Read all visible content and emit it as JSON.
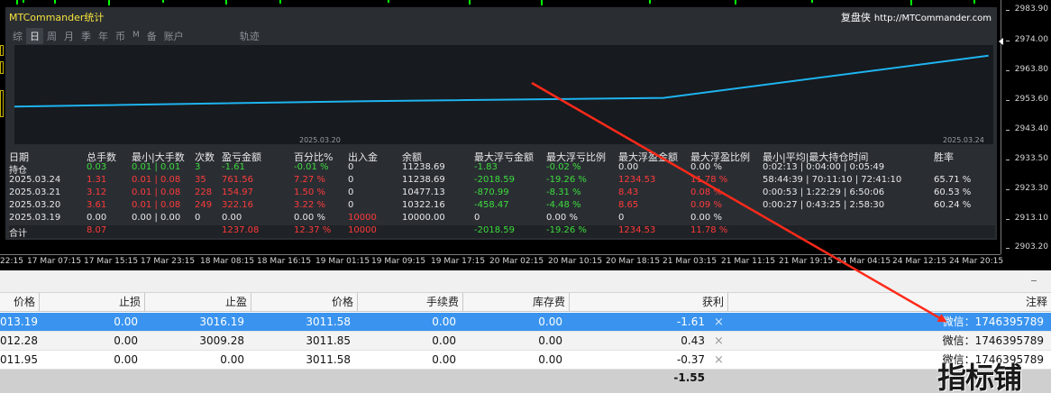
{
  "chart_window": {
    "price_axis": [
      "2983.90",
      "2974.00",
      "2963.80",
      "2953.60",
      "2943.40",
      "2933.50",
      "2923.30",
      "2913.10",
      "2903.20"
    ],
    "time_axis": [
      "22:15",
      "17 Mar 07:15",
      "17 Mar 15:15",
      "17 Mar 23:15",
      "18 Mar 08:15",
      "18 Mar 16:15",
      "19 Mar 01:15",
      "19 Mar 09:15",
      "19 Mar 17:15",
      "20 Mar 02:15",
      "20 Mar 10:15",
      "20 Mar 18:15",
      "21 Mar 03:15",
      "21 Mar 11:15",
      "21 Mar 19:15",
      "24 Mar 04:15",
      "24 Mar 12:15",
      "24 Mar 20:15"
    ]
  },
  "panel": {
    "title": "MTCommander统计",
    "brand": "复盘侠",
    "url": "http://MTCommander.com",
    "tabs": [
      "综",
      "日",
      "周",
      "月",
      "季",
      "年",
      "币",
      "M",
      "备",
      "账户",
      "轨迹"
    ],
    "active_tab": "日",
    "plot_start_date": "2025.03.20",
    "plot_end_date": "2025.03.24",
    "line_color": "#1eb4f0"
  },
  "chart_data": {
    "type": "line",
    "x": [
      "2025.03.20",
      "2025.03.21",
      "2025.03.24",
      "2025.03.24"
    ],
    "y": [
      10322.16,
      10477.13,
      10477.13,
      11238.69
    ]
  },
  "stats": {
    "headers": [
      "日期",
      "总手数",
      "最小|大手数",
      "次数",
      "盈亏金额",
      "百分比%",
      "出入金",
      "余额",
      "最大浮亏金额",
      "最大浮亏比例",
      "最大浮盈金额",
      "最大浮盈比例",
      "最小|平均|最大持仓时间",
      "胜率"
    ],
    "rows": [
      {
        "date": "持仓",
        "lots": "0.03",
        "minmax": "0.01 | 0.01",
        "count": "3",
        "pnl": "-1.61",
        "pct": "-0.01 %",
        "flow": "0",
        "balance": "11238.69",
        "max_dd": "-1.83",
        "max_dd_pct": "-0.02 %",
        "max_fp": "0.00",
        "max_fp_pct": "0.00 %",
        "hold": "0:02:13 | 0:04:00 | 0:05:49",
        "win": "",
        "tone": "green"
      },
      {
        "date": "2025.03.24",
        "lots": "1.31",
        "minmax": "0.01 | 0.08",
        "count": "35",
        "pnl": "761.56",
        "pct": "7.27 %",
        "flow": "0",
        "balance": "11238.69",
        "max_dd": "-2018.59",
        "max_dd_pct": "-19.26 %",
        "max_fp": "1234.53",
        "max_fp_pct": "11.78 %",
        "hold": "58:44:39 | 70:11:10 | 72:41:10",
        "win": "65.71 %",
        "tone": "red"
      },
      {
        "date": "2025.03.21",
        "lots": "3.12",
        "minmax": "0.01 | 0.08",
        "count": "228",
        "pnl": "154.97",
        "pct": "1.50 %",
        "flow": "0",
        "balance": "10477.13",
        "max_dd": "-870.99",
        "max_dd_pct": "-8.31 %",
        "max_fp": "8.43",
        "max_fp_pct": "0.08 %",
        "hold": "0:00:53 | 1:22:29 | 6:50:06",
        "win": "60.53 %",
        "tone": "red"
      },
      {
        "date": "2025.03.20",
        "lots": "3.61",
        "minmax": "0.01 | 0.08",
        "count": "249",
        "pnl": "322.16",
        "pct": "3.22 %",
        "flow": "0",
        "balance": "10322.16",
        "max_dd": "-458.47",
        "max_dd_pct": "-4.48 %",
        "max_fp": "8.65",
        "max_fp_pct": "0.09 %",
        "hold": "0:00:27 | 0:43:25 | 2:58:30",
        "win": "60.24 %",
        "tone": "red"
      },
      {
        "date": "2025.03.19",
        "lots": "0.00",
        "minmax": "0.00 | 0.00",
        "count": "0",
        "pnl": "0.00",
        "pct": "0.00 %",
        "flow": "10000",
        "balance": "10000.00",
        "max_dd": "0",
        "max_dd_pct": "0.00 %",
        "max_fp": "0",
        "max_fp_pct": "0.00 %",
        "hold": "",
        "win": "",
        "tone": "white"
      }
    ],
    "total": {
      "label": "合计",
      "lots": "8.07",
      "pnl": "1237.08",
      "pct": "12.37 %",
      "flow": "10000",
      "max_dd": "-2018.59",
      "max_dd_pct": "-19.26 %",
      "max_fp": "1234.53",
      "max_fp_pct": "11.78 %"
    }
  },
  "terminal": {
    "headers": {
      "price": "价格",
      "sl": "止损",
      "tp": "止盈",
      "price2": "价格",
      "commission": "手续费",
      "swap": "库存费",
      "profit": "获利",
      "comment": "注释"
    },
    "rows": [
      {
        "price": "013.19",
        "sl": "0.00",
        "tp": "3016.19",
        "price2": "3011.58",
        "commission": "0.00",
        "swap": "0.00",
        "profit": "-1.61",
        "comment": "微信：1746395789"
      },
      {
        "price": "012.28",
        "sl": "0.00",
        "tp": "3009.28",
        "price2": "3011.85",
        "commission": "0.00",
        "swap": "0.00",
        "profit": "0.43",
        "comment": "微信：1746395789"
      },
      {
        "price": "011.95",
        "sl": "0.00",
        "tp": "0.00",
        "price2": "3011.58",
        "commission": "0.00",
        "swap": "0.00",
        "profit": "-0.37",
        "comment": "微信：1746395789"
      }
    ],
    "total_profit": "-1.55",
    "close_icon": "×"
  },
  "watermark": "指标铺"
}
